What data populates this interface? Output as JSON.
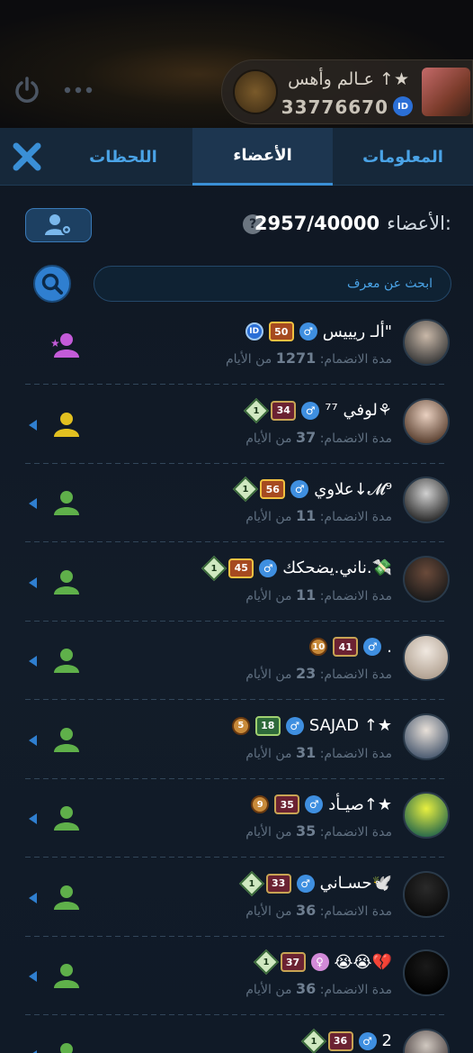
{
  "room": {
    "name": "عـالم وأهس ↑★",
    "id": "33776670",
    "id_badge": "ID"
  },
  "tabs": {
    "info": "المعلومات",
    "members": "الأعضاء",
    "moments": "اللحظات"
  },
  "members_header": {
    "label": "الأعضاء:",
    "count": "2957/40000",
    "help": "?"
  },
  "search": {
    "placeholder": "ابحث عن معرف"
  },
  "duration_prefix": "مدة الانضمام:",
  "duration_suffix": "من الأيام",
  "members": [
    {
      "name": "ألـ ريييس\"",
      "days": "1271",
      "badges": [
        "50",
        "ID"
      ],
      "gender": "male",
      "role": "admin",
      "role_color": "#c35bd8"
    },
    {
      "name": "لوفي ⁷⁷⚘",
      "days": "37",
      "badges": [
        "34",
        "1"
      ],
      "gender": "male",
      "role": "member",
      "role_color": "#e2c020"
    },
    {
      "name": "علاوي↓𝓜⁹",
      "days": "11",
      "badges": [
        "56",
        "1"
      ],
      "gender": "male",
      "role": "member",
      "role_color": "#5fb04a"
    },
    {
      "name": "ناني.يضحكك.💸",
      "days": "11",
      "badges": [
        "45",
        "1"
      ],
      "gender": "male",
      "role": "member",
      "role_color": "#5fb04a"
    },
    {
      "name": ".",
      "days": "23",
      "badges": [
        "41",
        "10"
      ],
      "gender": "male",
      "role": "member",
      "role_color": "#5fb04a"
    },
    {
      "name": "SAJAD ↑★",
      "days": "31",
      "badges": [
        "18",
        "5"
      ],
      "gender": "male",
      "role": "member",
      "role_color": "#5fb04a"
    },
    {
      "name": "صيـأد↑★",
      "days": "35",
      "badges": [
        "35",
        "9"
      ],
      "gender": "male",
      "role": "member",
      "role_color": "#5fb04a"
    },
    {
      "name": "حسـاني🕊️",
      "days": "36",
      "badges": [
        "33",
        "1"
      ],
      "gender": "male",
      "role": "member",
      "role_color": "#5fb04a"
    },
    {
      "name": "😭😭💔",
      "days": "36",
      "badges": [
        "37",
        "1"
      ],
      "gender": "female",
      "role": "member",
      "role_color": "#5fb04a"
    },
    {
      "name": "2",
      "days": "",
      "badges": [
        "36",
        "1"
      ],
      "gender": "male",
      "role": "member",
      "role_color": "#5fb04a"
    }
  ]
}
